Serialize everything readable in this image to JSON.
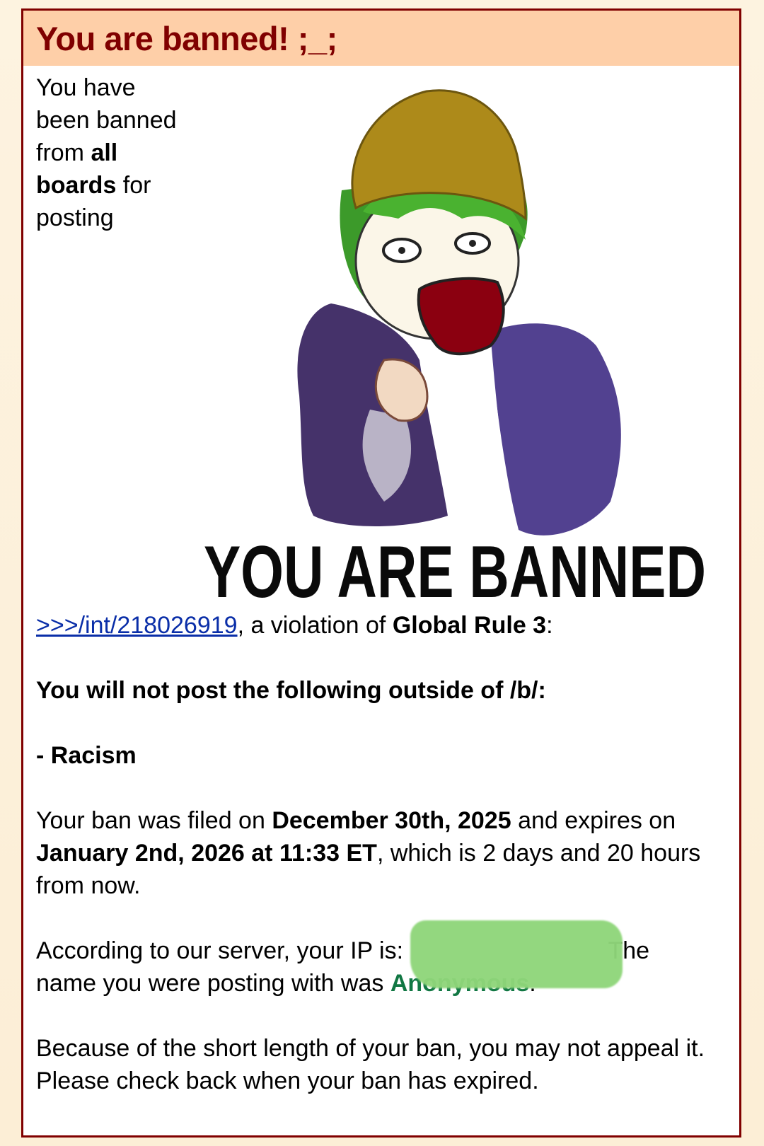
{
  "header": {
    "title": "You are banned! ;_;"
  },
  "intro": {
    "before_bold": "You have been banned from ",
    "bold_scope": "all boards",
    "after_bold": " for posting"
  },
  "image": {
    "caption": "YOU ARE BANNED",
    "icon": "banned-character-illustration"
  },
  "violation": {
    "post_link": ">>>/int/218026919",
    "middle": ", a violation of ",
    "rule": "Global Rule 3",
    "end": ":"
  },
  "rule_text": {
    "heading": "You will not post the following outside of /b/:",
    "item": "- Racism"
  },
  "ban_dates": {
    "prefix": "Your ban was filed on ",
    "filed_date": "December 30th, 2025",
    "middle": " and expires on ",
    "expiry_date": "January 2nd, 2026 at 11:33 ET",
    "suffix": ", which is 2 days and 20 hours from now."
  },
  "ip_info": {
    "prefix": "According to our server, your IP is: ",
    "after_ip": "The name you were posting with was ",
    "name": "Anonymous",
    "end": "."
  },
  "appeal": {
    "text": "Because of the short length of your ban, you may not appeal it. Please check back when your ban has expired."
  },
  "colors": {
    "header_bg": "#fecfa8",
    "title": "#800000",
    "border": "#800000",
    "link": "#0a2ea8",
    "name": "#117743",
    "redaction": "#8fd67a"
  }
}
